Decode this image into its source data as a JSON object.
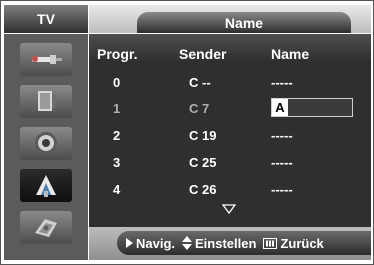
{
  "header": {
    "tv_label": "TV",
    "title": "Name"
  },
  "sidebar": {
    "icons": [
      "antenna-plug-icon",
      "picture-icon",
      "speaker-icon",
      "satellite-dish-icon",
      "setup-icon"
    ],
    "active_index": 3
  },
  "table": {
    "headers": [
      "Progr.",
      "Sender",
      "Name"
    ],
    "rows": [
      {
        "progr": "0",
        "sender": "C --",
        "name": "-----"
      },
      {
        "progr": "1",
        "sender": "C 7",
        "name": "A"
      },
      {
        "progr": "2",
        "sender": "C 19",
        "name": "-----"
      },
      {
        "progr": "3",
        "sender": "C 25",
        "name": "-----"
      },
      {
        "progr": "4",
        "sender": "C 26",
        "name": "-----"
      }
    ],
    "selected_index": 1
  },
  "footer": {
    "navig": "Navig.",
    "einstellen": "Einstellen",
    "zuruck": "Zurück"
  }
}
